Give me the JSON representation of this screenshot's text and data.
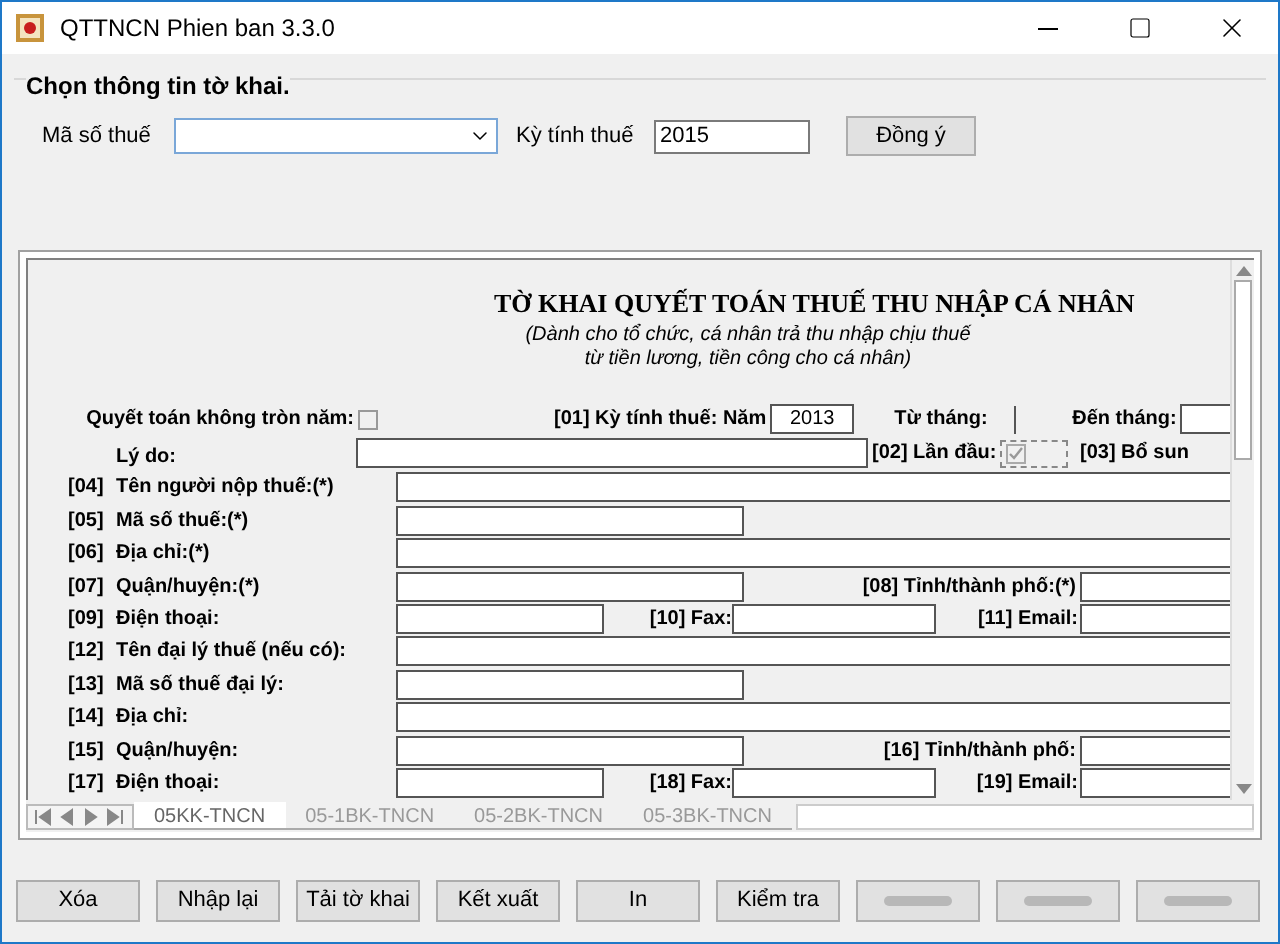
{
  "window": {
    "title": "QTTNCN Phien ban 3.3.0"
  },
  "selector": {
    "heading": "Chọn thông tin tờ khai.",
    "tax_code_label": "Mã số thuế",
    "period_label": "Kỳ tính thuế",
    "period_value": "2015",
    "confirm_button": "Đồng ý"
  },
  "form": {
    "title": "TỜ KHAI QUYẾT TOÁN THUẾ THU NHẬP CÁ NHÂN",
    "subtitle": [
      "(Dành cho tổ chức, cá nhân trả thu nhập chịu thuế",
      "từ tiền lương, tiền công cho cá nhân)"
    ],
    "period_row": {
      "partial_year_label": "Quyết toán không tròn năm:",
      "partial_year_checked": false,
      "period_label": "[01] Kỳ tính thuế: Năm",
      "year": "2013",
      "from_label": "Từ tháng:",
      "to_label": "Đến tháng:"
    },
    "reason_row": {
      "reason_label": "Lý do:",
      "first_label": "[02] Lần đầu:",
      "first_checked": true,
      "supplement_label": "[03] Bổ sun"
    },
    "rows": [
      {
        "kind": "full",
        "code": "[04]",
        "label": "Tên người nộp thuế:(*)"
      },
      {
        "kind": "short",
        "code": "[05]",
        "label": "Mã số thuế:(*)"
      },
      {
        "kind": "full",
        "code": "[06]",
        "label": "Địa chỉ:(*)"
      },
      {
        "kind": "pair",
        "code": "[07]",
        "label": "Quận/huyện:(*)",
        "extras": [
          "[08]  Tỉnh/thành phố:(*)"
        ]
      },
      {
        "kind": "triple",
        "code": "[09]",
        "label": "Điện thoại:",
        "extras": [
          "[10] Fax:",
          "[11] Email:"
        ]
      },
      {
        "kind": "full",
        "code": "[12]",
        "label": "Tên đại lý thuế (nếu có):"
      },
      {
        "kind": "short",
        "code": "[13]",
        "label": "Mã số thuế đại lý:"
      },
      {
        "kind": "full",
        "code": "[14]",
        "label": "Địa chỉ:"
      },
      {
        "kind": "pair",
        "code": "[15]",
        "label": "Quận/huyện:",
        "extras": [
          "[16] Tỉnh/thành phố:"
        ]
      },
      {
        "kind": "triple",
        "code": "[17]",
        "label": "Điện thoại:",
        "extras": [
          "[18] Fax:",
          "[19] Email:"
        ]
      }
    ]
  },
  "sheet_tabs": [
    {
      "label": "05KK-TNCN",
      "selected": true
    },
    {
      "label": "05-1BK-TNCN",
      "selected": false
    },
    {
      "label": "05-2BK-TNCN",
      "selected": false
    },
    {
      "label": "05-3BK-TNCN",
      "selected": false
    }
  ],
  "buttons": [
    {
      "label": "Xóa"
    },
    {
      "label": "Nhập lại"
    },
    {
      "label": "Tải tờ khai"
    },
    {
      "label": "Kết xuất"
    },
    {
      "label": "In"
    },
    {
      "label": "Kiểm tra"
    },
    {
      "blurred": true
    },
    {
      "blurred": true
    },
    {
      "blurred": true
    }
  ]
}
